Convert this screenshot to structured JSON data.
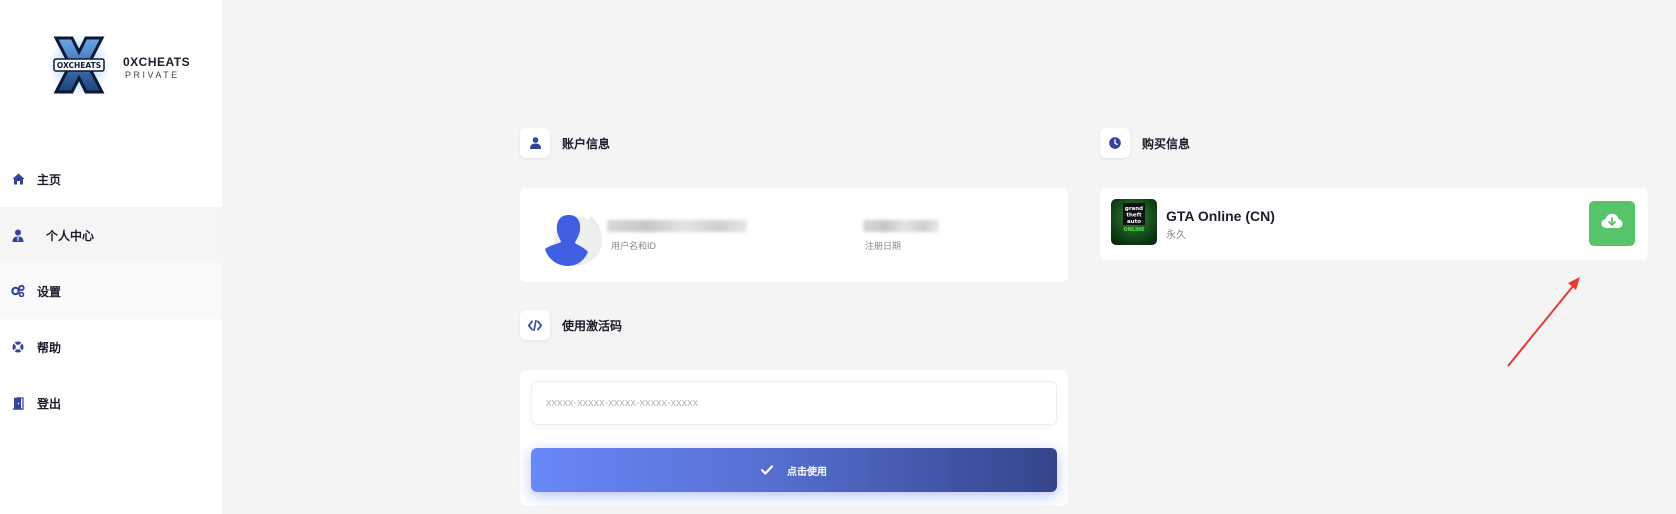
{
  "brand": {
    "title": "0XCHEATS",
    "subtitle": "PRIVATE",
    "logo_text": "OXCHEATS"
  },
  "nav": {
    "items": [
      {
        "label": "主页",
        "icon": "home-icon"
      },
      {
        "label": "个人中心",
        "icon": "user-tie-icon"
      },
      {
        "label": "设置",
        "icon": "gears-icon"
      },
      {
        "label": "帮助",
        "icon": "lifebuoy-icon"
      },
      {
        "label": "登出",
        "icon": "door-exit-icon"
      }
    ],
    "active_index": 1
  },
  "account": {
    "title": "账户信息",
    "icon": "user-icon",
    "username_label": "用户名和ID",
    "register_label": "注册日期"
  },
  "activation": {
    "title": "使用激活码",
    "icon": "code-icon",
    "placeholder": "xxxxx-xxxxx-xxxxx-xxxxx-xxxxx",
    "value": "",
    "button_label": "点击使用",
    "button_icon": "check-icon"
  },
  "purchases": {
    "title": "购买信息",
    "icon": "clock-icon",
    "items": [
      {
        "name": "GTA Online (CN)",
        "duration": "永久",
        "thumb_text": [
          "grand",
          "theft",
          "auto"
        ],
        "thumb_badge": "ONLINE",
        "action_icon": "cloud-download-icon"
      }
    ]
  },
  "colors": {
    "accent": "#34449a",
    "button_gradient_start": "#6888f8",
    "button_gradient_end": "#35448a",
    "download": "#57c36b",
    "annotation_arrow": "#e53935"
  }
}
